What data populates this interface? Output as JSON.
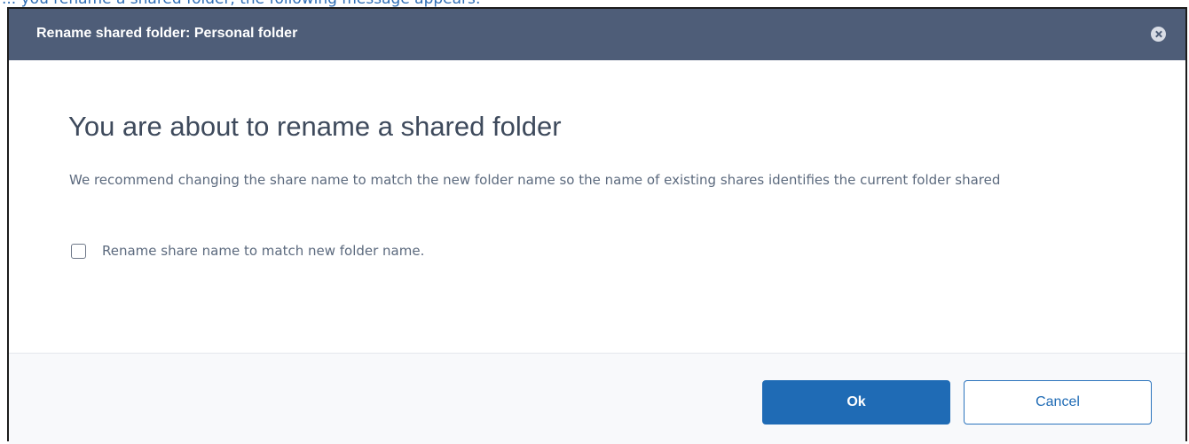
{
  "background_caption": "... you rename a shared folder, the following message appears:",
  "dialog": {
    "title": "Rename shared folder: Personal folder",
    "close_icon": "close-circle-icon",
    "heading": "You are about to rename a shared folder",
    "description": "We recommend changing the share name to match the new folder name so the name of existing shares identifies the current folder shared",
    "checkbox": {
      "label": "Rename share name to match new folder name.",
      "checked": false
    },
    "buttons": {
      "ok_label": "Ok",
      "cancel_label": "Cancel"
    }
  },
  "colors": {
    "titlebar": "#4e5d78",
    "primary_button": "#1f6bb5",
    "heading_text": "#3e4a5c",
    "body_text": "#5c6a7e"
  }
}
